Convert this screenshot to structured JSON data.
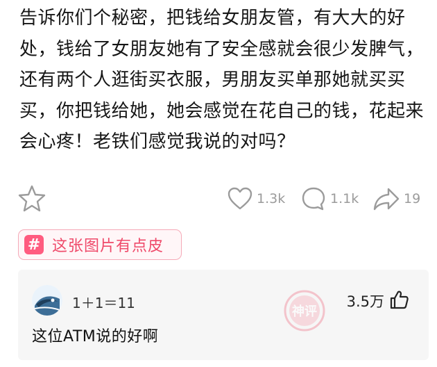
{
  "post": {
    "lines": [
      "告诉你们个秘密，把钱给女朋友管，有大大的好",
      "处，钱给了女朋友她有了安全感就会很少发脾气，",
      "还有两个人逛街买衣服，男朋友买单那她就买买",
      "买，你把钱给她，她会感觉在花自己的钱，花起来",
      "会心疼！老铁们感觉我说的对吗？"
    ]
  },
  "actions": {
    "like_count": "1.3k",
    "comment_count": "1.1k",
    "share_count": "19"
  },
  "topic": {
    "symbol": "#",
    "label": "这张图片有点皮"
  },
  "comment": {
    "username": "1＋1＝11",
    "likes": "3.5万",
    "text": "这位ATM说的好啊",
    "badge_text": "神评"
  },
  "colors": {
    "accent_pink": "#ff5c80",
    "tag_text": "#ef4a6a",
    "icon_gray": "#9b9b9b"
  },
  "icons": [
    "star-icon",
    "heart-icon",
    "comment-bubble-icon",
    "share-arrow-icon",
    "thumbs-up-icon"
  ]
}
